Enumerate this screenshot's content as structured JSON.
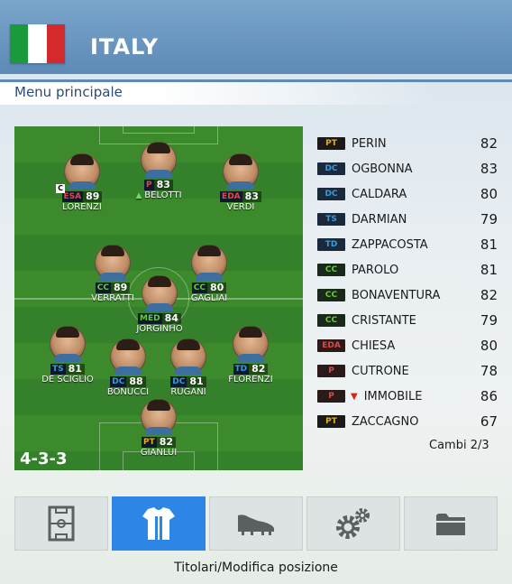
{
  "header": {
    "team": "ITALY",
    "flag_colors": [
      "#1a9a3a",
      "#ffffff",
      "#d42a2e"
    ]
  },
  "menu": {
    "title": "Menu principale"
  },
  "pitch": {
    "formation": "4-3-3",
    "players": [
      {
        "id": "lorenzi",
        "name": "LORENZI",
        "pos": "ESA",
        "ovr": "89",
        "captain": "C",
        "pos_color": "#e04848"
      },
      {
        "id": "belotti",
        "name": "BELOTTI",
        "pos": "P",
        "ovr": "83",
        "arrow": "▲",
        "pos_color": "#e04848"
      },
      {
        "id": "verdi",
        "name": "VERDI",
        "pos": "EDA",
        "ovr": "83",
        "pos_color": "#e04848"
      },
      {
        "id": "verratti",
        "name": "VERRATTI",
        "pos": "CC",
        "ovr": "89",
        "pos_color": "#66cc33"
      },
      {
        "id": "gagliai",
        "name": "GAGLIAI",
        "pos": "CC",
        "ovr": "80",
        "pos_color": "#66cc33"
      },
      {
        "id": "jorginho",
        "name": "JORGINHO",
        "pos": "MED",
        "ovr": "84",
        "pos_color": "#66cc33"
      },
      {
        "id": "desciglio",
        "name": "DE SCIGLIO",
        "pos": "TS",
        "ovr": "81",
        "pos_color": "#3a9ae0"
      },
      {
        "id": "bonucci",
        "name": "BONUCCI",
        "pos": "DC",
        "ovr": "88",
        "pos_color": "#3a9ae0"
      },
      {
        "id": "rugani",
        "name": "RUGANI",
        "pos": "DC",
        "ovr": "81",
        "pos_color": "#3a9ae0"
      },
      {
        "id": "florenzi",
        "name": "FLORENZI",
        "pos": "TD",
        "ovr": "82",
        "pos_color": "#3a9ae0"
      },
      {
        "id": "gianlui",
        "name": "GIANLUI",
        "pos": "PT",
        "ovr": "82",
        "pos_color": "#e0b020"
      }
    ]
  },
  "bench": [
    {
      "pos": "PT",
      "name": "PERIN",
      "ovr": "82",
      "pos_color": "#e0b020",
      "chip_bg": "#1a1a1a"
    },
    {
      "pos": "DC",
      "name": "OGBONNA",
      "ovr": "83",
      "pos_color": "#3a9ae0",
      "chip_bg": "#1a2a3a"
    },
    {
      "pos": "DC",
      "name": "CALDARA",
      "ovr": "80",
      "pos_color": "#3a9ae0",
      "chip_bg": "#1a2a3a"
    },
    {
      "pos": "TS",
      "name": "DARMIAN",
      "ovr": "79",
      "pos_color": "#3a9ae0",
      "chip_bg": "#1a2a3a"
    },
    {
      "pos": "TD",
      "name": "ZAPPACOSTA",
      "ovr": "81",
      "pos_color": "#3a9ae0",
      "chip_bg": "#1a2a3a"
    },
    {
      "pos": "CC",
      "name": "PAROLO",
      "ovr": "81",
      "pos_color": "#66cc33",
      "chip_bg": "#1a2a1a"
    },
    {
      "pos": "CC",
      "name": "BONAVENTURA",
      "ovr": "82",
      "pos_color": "#66cc33",
      "chip_bg": "#1a2a1a"
    },
    {
      "pos": "CC",
      "name": "CRISTANTE",
      "ovr": "79",
      "pos_color": "#66cc33",
      "chip_bg": "#1a2a1a"
    },
    {
      "pos": "EDA",
      "name": "CHIESA",
      "ovr": "80",
      "pos_color": "#e04848",
      "chip_bg": "#2a1a1a"
    },
    {
      "pos": "P",
      "name": "CUTRONE",
      "ovr": "78",
      "pos_color": "#e04848",
      "chip_bg": "#2a1a1a"
    },
    {
      "pos": "P",
      "name": "IMMOBILE",
      "ovr": "86",
      "arrow": "▼",
      "pos_color": "#e04848",
      "chip_bg": "#2a1a1a"
    },
    {
      "pos": "PT",
      "name": "ZACCAGNO",
      "ovr": "67",
      "pos_color": "#e0b020",
      "chip_bg": "#1a1a1a"
    }
  ],
  "subs": "Cambi 2/3",
  "tabs": [
    {
      "id": "pitch",
      "icon": "pitch-icon",
      "active": false
    },
    {
      "id": "jersey",
      "icon": "jersey-icon",
      "active": true
    },
    {
      "id": "boot",
      "icon": "boot-icon",
      "active": false
    },
    {
      "id": "settings",
      "icon": "gear-icon",
      "active": false
    },
    {
      "id": "folder",
      "icon": "folder-icon",
      "active": false
    }
  ],
  "caption": "Titolari/Modifica posizione",
  "accent": "#2d86e6"
}
